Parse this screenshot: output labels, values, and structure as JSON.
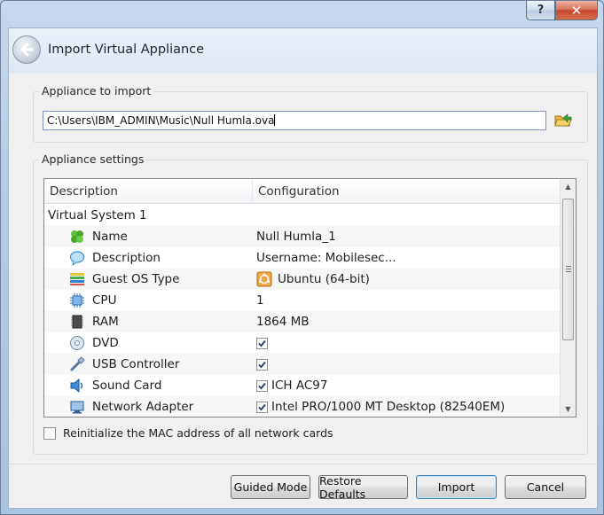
{
  "window": {
    "title": "Import Virtual Appliance"
  },
  "caption": {
    "help": "?",
    "close": "✕"
  },
  "appliance_group": {
    "title": "Appliance to import",
    "file_path": "C:\\Users\\IBM_ADMIN\\Music\\Null Humla.ova"
  },
  "settings_group": {
    "title": "Appliance settings",
    "columns": {
      "description": "Description",
      "configuration": "Configuration"
    },
    "system_label": "Virtual System 1",
    "rows": [
      {
        "label": "Name",
        "value": "Null Humla_1",
        "icon": "name-icon"
      },
      {
        "label": "Description",
        "value": "Username: Mobilesec...",
        "icon": "description-icon"
      },
      {
        "label": "Guest OS Type",
        "value": "Ubuntu (64-bit)",
        "icon": "guest-os-icon"
      },
      {
        "label": "CPU",
        "value": "1",
        "icon": "cpu-icon"
      },
      {
        "label": "RAM",
        "value": "1864 MB",
        "icon": "ram-icon"
      },
      {
        "label": "DVD",
        "value": "",
        "checked": true,
        "icon": "dvd-icon"
      },
      {
        "label": "USB Controller",
        "value": "",
        "checked": true,
        "icon": "usb-icon"
      },
      {
        "label": "Sound Card",
        "value": "ICH AC97",
        "checked": true,
        "icon": "sound-card-icon"
      },
      {
        "label": "Network Adapter",
        "value": "Intel PRO/1000 MT Desktop (82540EM)",
        "checked": true,
        "icon": "network-adapter-icon"
      }
    ]
  },
  "mac_option": {
    "label": "Reinitialize the MAC address of all network cards",
    "checked": false
  },
  "buttons": {
    "guided_mode": "Guided Mode",
    "restore_defaults": "Restore Defaults",
    "import": "Import",
    "cancel": "Cancel"
  }
}
